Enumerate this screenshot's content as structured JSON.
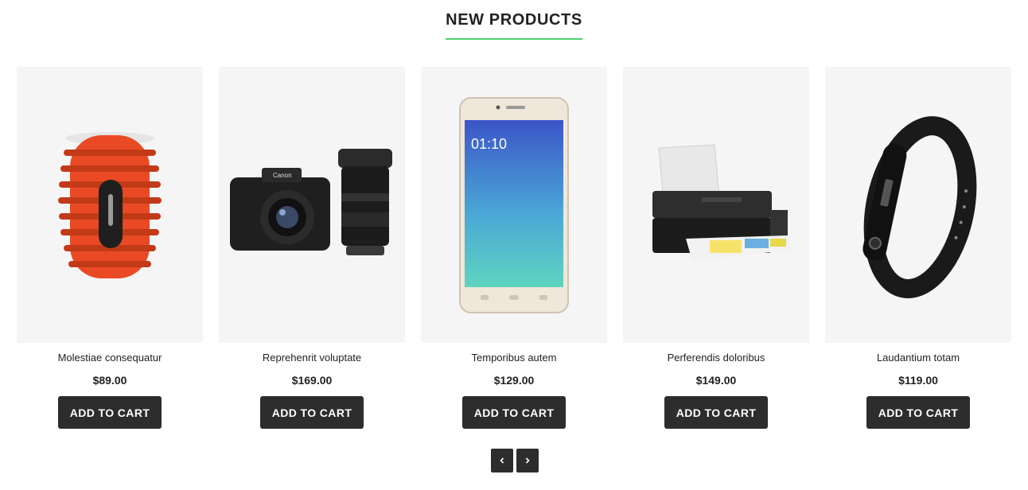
{
  "section": {
    "title": "NEW PRODUCTS"
  },
  "products": [
    {
      "name": "Molestiae consequatur",
      "price": "$89.00",
      "button": "ADD TO CART"
    },
    {
      "name": "Reprehenrit voluptate",
      "price": "$169.00",
      "button": "ADD TO CART"
    },
    {
      "name": "Temporibus autem",
      "price": "$129.00",
      "button": "ADD TO CART"
    },
    {
      "name": "Perferendis doloribus",
      "price": "$149.00",
      "button": "ADD TO CART"
    },
    {
      "name": "Laudantium totam",
      "price": "$119.00",
      "button": "ADD TO CART"
    }
  ],
  "phone_screen": {
    "time": "01:10"
  },
  "camera": {
    "brand": "Canon"
  },
  "pager": {
    "prev_icon": "chevron-left-icon",
    "next_icon": "chevron-right-icon"
  },
  "colors": {
    "accent": "#4cd16b",
    "button": "#2d2d2d",
    "thumb_bg": "#f5f5f5"
  }
}
